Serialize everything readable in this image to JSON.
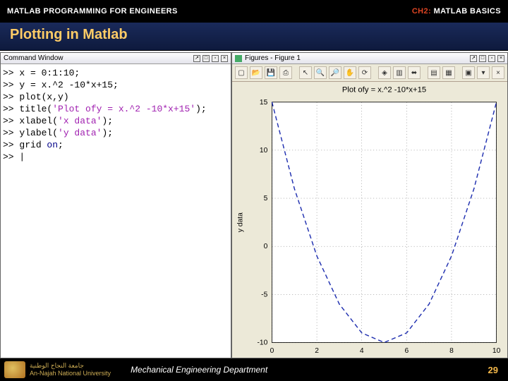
{
  "header": {
    "left": "MATLAB PROGRAMMING FOR ENGINEERS",
    "chapter_prefix": "CH2:",
    "chapter_title": "MATLAB BASICS"
  },
  "slide_title": "Plotting in Matlab",
  "command_window": {
    "title": "Command Window",
    "lines": [
      {
        "prompt": ">>",
        "code": " x = 0:1:10;"
      },
      {
        "prompt": ">>",
        "code": " y = x.^2 -10*x+15;"
      },
      {
        "prompt": ">>",
        "code": " plot(x,y)"
      },
      {
        "prompt": ">>",
        "code_pre": " title(",
        "str": "'Plot ofy = x.^2 -10*x+15'",
        "code_post": ");"
      },
      {
        "prompt": ">>",
        "code_pre": " xlabel(",
        "str": "'x data'",
        "code_post": ");"
      },
      {
        "prompt": ">>",
        "code_pre": " ylabel(",
        "str": "'y data'",
        "code_post": ");"
      },
      {
        "prompt": ">>",
        "code_pre": " grid ",
        "kw": "on",
        "code_post": ";"
      },
      {
        "prompt": ">>",
        "code": " |"
      }
    ]
  },
  "figure_window": {
    "title": "Figures - Figure 1",
    "toolbar_icons": [
      "new-icon",
      "open-icon",
      "save-icon",
      "print-icon",
      "",
      "pointer-icon",
      "zoom-in-icon",
      "zoom-out-icon",
      "pan-icon",
      "rotate-icon",
      "",
      "datacursor-icon",
      "brush-icon",
      "link-icon",
      "",
      "colorbar-icon",
      "legend-icon",
      "",
      "dock-icon",
      "chevron-down-icon",
      "close-icon"
    ]
  },
  "chart_data": {
    "type": "line",
    "title": "Plot ofy = x.^2 -10*x+15",
    "xlabel": "x data",
    "ylabel": "y data",
    "x": [
      0,
      1,
      2,
      3,
      4,
      5,
      6,
      7,
      8,
      9,
      10
    ],
    "y": [
      15,
      6,
      -1,
      -6,
      -9,
      -10,
      -9,
      -6,
      -1,
      6,
      15
    ],
    "xlim": [
      0,
      10
    ],
    "ylim": [
      -10,
      15
    ],
    "xticks": [
      0,
      2,
      4,
      6,
      8,
      10
    ],
    "yticks": [
      -10,
      -5,
      0,
      5,
      10,
      15
    ],
    "grid": true,
    "line_color": "#2030b0",
    "line_style": "dashed"
  },
  "footer": {
    "university_ar": "جامعة النجاح الوطنية",
    "university_en": "An-Najah National University",
    "department": "Mechanical Engineering Department",
    "page": "29"
  }
}
